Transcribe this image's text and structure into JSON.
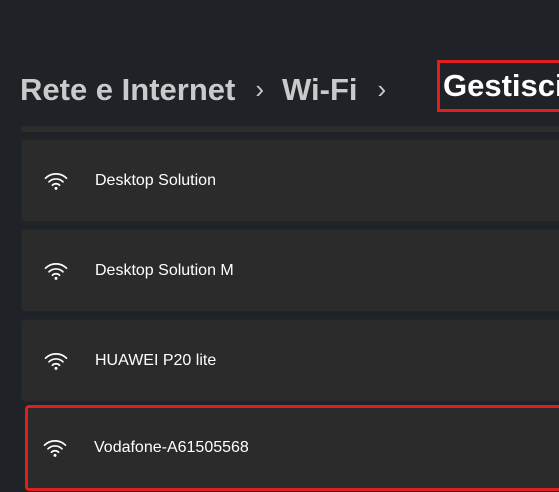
{
  "breadcrumb": {
    "items": [
      "Rete e Internet",
      "Wi-Fi"
    ],
    "separator": "›",
    "current": "Gestisci"
  },
  "networks": [
    {
      "name": "Desktop Solution",
      "icon": "wifi-icon"
    },
    {
      "name": "Desktop Solution M",
      "icon": "wifi-icon"
    },
    {
      "name": "HUAWEI P20 lite",
      "icon": "wifi-icon"
    },
    {
      "name": "Vodafone-A61505568",
      "icon": "wifi-icon"
    }
  ],
  "colors": {
    "background": "#1f2327",
    "card": "#2b2b2b",
    "highlight": "#e01e1e",
    "text": "#ffffff",
    "breadcrumb_text": "#c9cacb"
  }
}
